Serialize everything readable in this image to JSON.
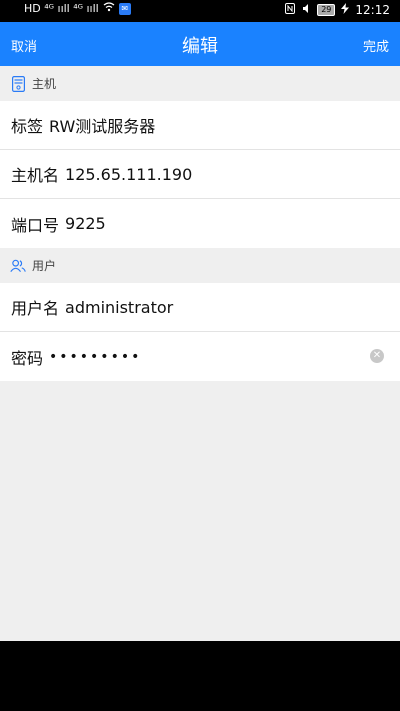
{
  "status_bar": {
    "left_indicators": "HD ⁴ᴳ ııll ⁴ᴳ ııll",
    "battery": "29",
    "time": "12:12"
  },
  "nav": {
    "cancel": "取消",
    "title": "编辑",
    "done": "完成"
  },
  "sections": {
    "host": {
      "header": "主机",
      "label_field": {
        "label": "标签",
        "value": "RW测试服务器"
      },
      "hostname_field": {
        "label": "主机名",
        "value": "125.65.111.190"
      },
      "port_field": {
        "label": "端口号",
        "value": "9225"
      }
    },
    "user": {
      "header": "用户",
      "username_field": {
        "label": "用户名",
        "value": "administrator"
      },
      "password_field": {
        "label": "密码",
        "value": "•••••••••"
      }
    }
  },
  "colors": {
    "accent": "#1a82ff",
    "background": "#efefef"
  }
}
